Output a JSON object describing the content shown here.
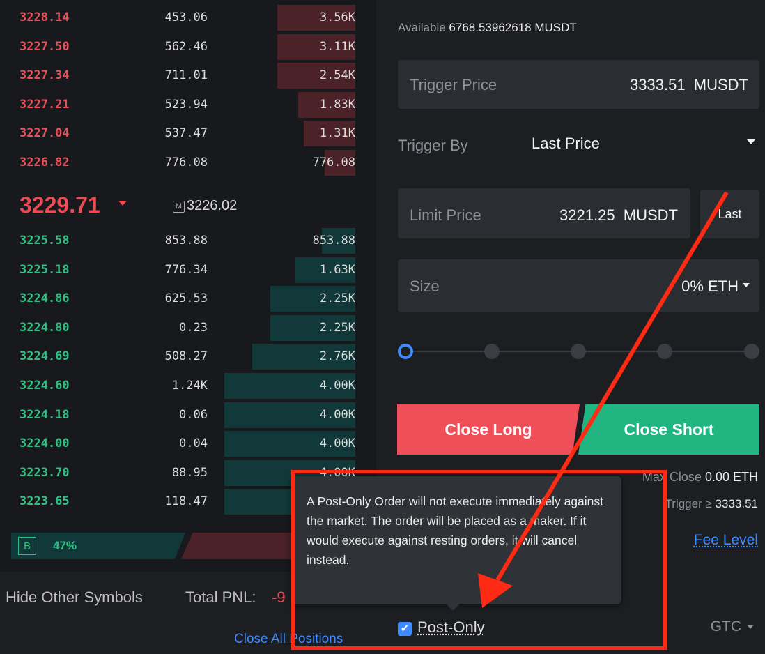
{
  "orderbook": {
    "asks": [
      {
        "price": "3228.14",
        "qty": "453.06",
        "total": "3.56K",
        "depth": 0.56
      },
      {
        "price": "3227.50",
        "qty": "562.46",
        "total": "3.11K",
        "depth": 0.56
      },
      {
        "price": "3227.34",
        "qty": "711.01",
        "total": "2.54K",
        "depth": 0.56
      },
      {
        "price": "3227.21",
        "qty": "523.94",
        "total": "1.83K",
        "depth": 0.41
      },
      {
        "price": "3227.04",
        "qty": "537.47",
        "total": "1.31K",
        "depth": 0.37
      },
      {
        "price": "3226.82",
        "qty": "776.08",
        "total": "776.08",
        "depth": 0.22
      }
    ],
    "last_price": "3229.71",
    "mark_price": "3226.02",
    "mark_icon": "M",
    "bids": [
      {
        "price": "3225.58",
        "qty": "853.88",
        "total": "853.88",
        "depth": 0.24
      },
      {
        "price": "3225.18",
        "qty": "776.34",
        "total": "1.63K",
        "depth": 0.43
      },
      {
        "price": "3224.86",
        "qty": "625.53",
        "total": "2.25K",
        "depth": 0.61
      },
      {
        "price": "3224.80",
        "qty": "0.23",
        "total": "2.25K",
        "depth": 0.61
      },
      {
        "price": "3224.69",
        "qty": "508.27",
        "total": "2.76K",
        "depth": 0.74
      },
      {
        "price": "3224.60",
        "qty": "1.24K",
        "total": "4.00K",
        "depth": 0.94
      },
      {
        "price": "3224.18",
        "qty": "0.06",
        "total": "4.00K",
        "depth": 0.94
      },
      {
        "price": "3224.00",
        "qty": "0.04",
        "total": "4.00K",
        "depth": 0.94
      },
      {
        "price": "3223.70",
        "qty": "88.95",
        "total": "4.00K",
        "depth": 0.94
      },
      {
        "price": "3223.65",
        "qty": "118.47",
        "total": "",
        "depth": 0.94
      }
    ],
    "buy_label": "B",
    "buy_pct": "47%"
  },
  "footer": {
    "hide_label": "Hide Other Symbols",
    "pnl_label": "Total PNL:",
    "pnl_value": "-9",
    "close_all": "Close All Positions"
  },
  "form": {
    "available_label": "Available",
    "available_value": "6768.53962618 MUSDT",
    "trigger_price_label": "Trigger Price",
    "trigger_price_value": "3333.51  MUSDT",
    "trigger_by_label": "Trigger By",
    "trigger_by_value": "Last Price",
    "limit_price_label": "Limit Price",
    "limit_price_value": "3221.25  MUSDT",
    "last_button": "Last",
    "size_label": "Size",
    "size_value": "0% ETH",
    "slider_level": 0,
    "close_long": "Close Long",
    "close_short": "Close Short",
    "max_close_label": "Max Close",
    "max_close_value": "0.00 ETH",
    "trigger_cond_label": "Trigger ≥",
    "trigger_cond_value": "3333.51",
    "fee_level": "Fee Level",
    "post_only": "Post-Only",
    "tif": "GTC"
  },
  "tooltip": {
    "text": "A Post-Only Order will not execute immediately against the market. The order will be placed as a maker. If it would execute against resting orders, it will cancel instead."
  },
  "colors": {
    "ask": "#e9505a",
    "bid": "#2fc082",
    "accent": "#3d8bff",
    "annotation": "#ff2a14"
  }
}
